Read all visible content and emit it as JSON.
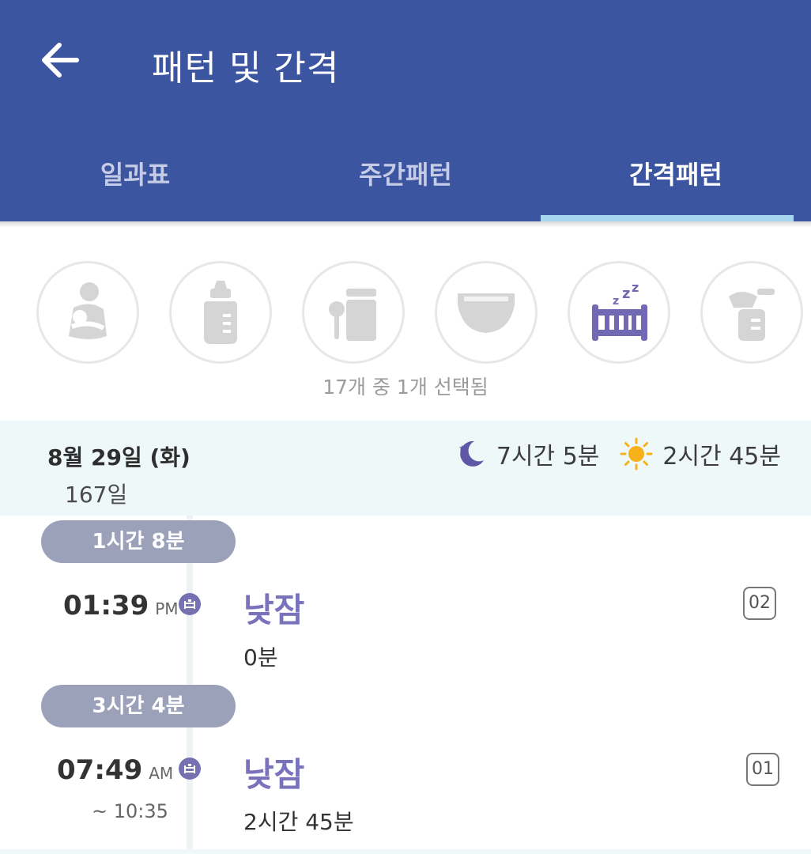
{
  "header": {
    "title": "패턴 및 간격",
    "back_icon": "arrow-left-icon",
    "color": "#3c55a0"
  },
  "tabs": [
    {
      "label": "일과표",
      "active": false
    },
    {
      "label": "주간패턴",
      "active": false
    },
    {
      "label": "간격패턴",
      "active": true
    }
  ],
  "filters": {
    "icons": [
      "breastfeeding-icon",
      "bottle-icon",
      "baby-food-icon",
      "diaper-icon",
      "sleep-crib-icon",
      "breast-pump-icon"
    ],
    "selected": "sleep-crib-icon",
    "selected_count_text": "17개 중 1개 선택됨"
  },
  "day": {
    "date": "8월 29일 (화)",
    "age": "167일",
    "night_icon": "moon-icon",
    "night_total": "7시간 5분",
    "day_icon": "sun-icon",
    "day_total": "2시간 45분"
  },
  "timeline": {
    "entries": [
      {
        "interval": "1시간 8분",
        "time": "01:39",
        "ampm": "PM",
        "end_time": "",
        "name": "낮잠",
        "duration": "0분",
        "badge": "02"
      },
      {
        "interval": "3시간 4분",
        "time": "07:49",
        "ampm": "AM",
        "end_time": "~ 10:35",
        "name": "낮잠",
        "duration": "2시간 45분",
        "badge": "01"
      }
    ]
  },
  "colors": {
    "accent": "#7a72ba",
    "tab_indicator": "#a6d6ef",
    "day_header_bg": "#eef8f9"
  }
}
